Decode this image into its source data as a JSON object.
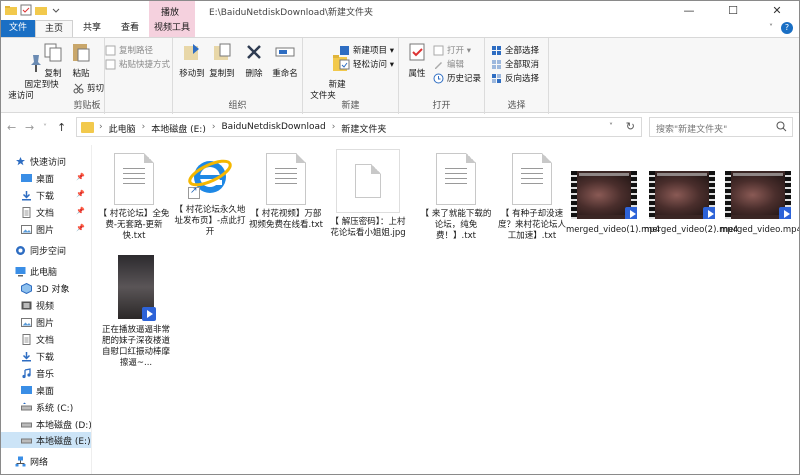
{
  "title_bar": {
    "context_group": "播放",
    "path": "E:\\BaiduNetdiskDownload\\新建文件夹",
    "minimize": "—",
    "maximize": "☐",
    "close": "✕"
  },
  "tabs": {
    "file": "文件",
    "home": "主页",
    "share": "共享",
    "view": "查看",
    "video_tools": "视频工具",
    "help": "?",
    "collapse": "˅"
  },
  "ribbon": {
    "clipboard": {
      "pin": "固定到快\n速访问",
      "copy": "复制",
      "paste": "粘贴",
      "copy_path": "复制路径",
      "paste_shortcut": "粘贴快捷方式",
      "cut": "剪切",
      "label": "剪贴板"
    },
    "organize": {
      "move_to": "移动到",
      "copy_to": "复制到",
      "delete": "删除",
      "rename": "重命名",
      "label": "组织"
    },
    "new": {
      "new_folder": "新建\n文件夹",
      "new_item": "新建项目 ▾",
      "easy_access": "轻松访问 ▾",
      "label": "新建"
    },
    "open": {
      "properties": "属性",
      "open": "打开 ▾",
      "edit": "编辑",
      "history": "历史记录",
      "label": "打开"
    },
    "select": {
      "select_all": "全部选择",
      "select_none": "全部取消",
      "invert": "反向选择",
      "label": "选择"
    }
  },
  "address": {
    "back": "←",
    "forward": "→",
    "dropdown": "˅",
    "up": "↑",
    "crumbs": [
      "此电脑",
      "本地磁盘 (E:)",
      "BaiduNetdiskDownload",
      "新建文件夹"
    ],
    "sep": "›",
    "refresh": "↻",
    "search_placeholder": "搜索\"新建文件夹\""
  },
  "nav": {
    "quick_access": "快速访问",
    "desktop": "桌面",
    "downloads": "下载",
    "documents": "文档",
    "pictures": "图片",
    "sync": "同步空间",
    "this_pc": "此电脑",
    "objects3d": "3D 对象",
    "videos": "视频",
    "pictures2": "图片",
    "documents2": "文档",
    "downloads2": "下载",
    "music": "音乐",
    "desktop2": "桌面",
    "drive_c": "系统 (C:)",
    "drive_d": "本地磁盘 (D:)",
    "drive_e": "本地磁盘 (E:)",
    "network": "网络",
    "pin": "📌"
  },
  "files": [
    {
      "name": "【 村花论坛】全免费-无套路-更新快.txt"
    },
    {
      "name": "【 村花论坛永久地址发布页】-点此打开"
    },
    {
      "name": "【 村花视频】万部视频免费在线看.txt"
    },
    {
      "name": "【 解压密码】：上村花论坛看小姐姐.jpg"
    },
    {
      "name": "【 来了就能下载的论坛，纯免费！】.txt"
    },
    {
      "name": "【 有种子却没速度？来村花论坛人工加速】.txt"
    },
    {
      "name": "merged_video(1).mp4"
    },
    {
      "name": "merged_video(2).mp4"
    },
    {
      "name": "merged_video.mp4"
    },
    {
      "name": "正在播放逼逼非常肥的妹子深夜楼道自慰口红振动棒摩擦逼~..."
    }
  ],
  "colors": {
    "file_tab": "#1a6fc4",
    "context_tab": "#f5d1de",
    "selected_nav": "#cce4f7",
    "play_badge": "#2d63d8"
  }
}
